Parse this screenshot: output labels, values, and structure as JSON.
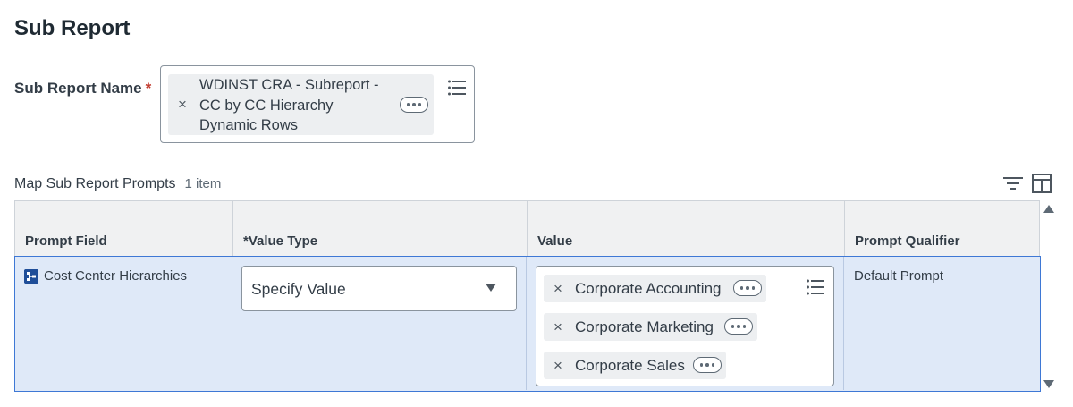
{
  "page": {
    "title": "Sub Report"
  },
  "sub_report_field": {
    "label": "Sub Report Name",
    "required_marker": "*",
    "selected": {
      "line1": "WDINST CRA - Subreport -",
      "line2": "CC by CC Hierarchy",
      "line3": "Dynamic Rows"
    },
    "remove_glyph": "×",
    "prompt_icon": "list-icon",
    "more_icon": "ellipsis-icon"
  },
  "grid": {
    "title": "Map Sub Report Prompts",
    "count": "1 item",
    "toolbar_icons": [
      "filter-icon",
      "layout-columns-icon"
    ],
    "columns": [
      "Prompt Field",
      "*Value Type",
      "Value",
      "Prompt Qualifier"
    ],
    "rows": [
      {
        "prompt_field": "Cost Center Hierarchies",
        "prompt_field_icon": "hierarchy-icon",
        "value_type": "Specify Value",
        "values": [
          "Corporate Accounting",
          "Corporate Marketing",
          "Corporate Sales"
        ],
        "prompt_qualifier": "Default Prompt"
      }
    ]
  },
  "colors": {
    "selected_row_bg": "#dfe9f8",
    "selected_row_border": "#3e78d5",
    "required": "#c23a2e",
    "pill_bg": "#edeff1"
  }
}
